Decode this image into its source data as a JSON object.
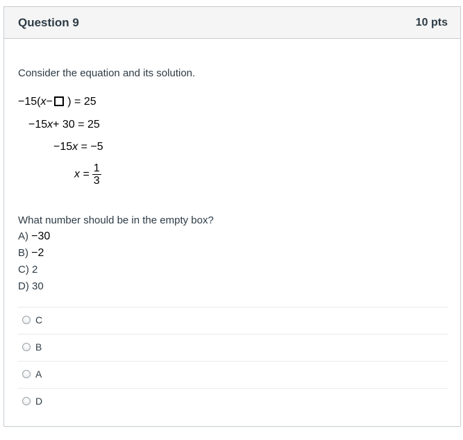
{
  "header": {
    "title": "Question 9",
    "points": "10 pts"
  },
  "prompt": "Consider the equation and its solution.",
  "equations": {
    "line1_prefix": "−15(",
    "line1_var": "x",
    "line1_minus": "−",
    "line1_suffix": " ) = 25",
    "line2_left": "−15",
    "line2_var": "x",
    "line2_right": "+ 30 = 25",
    "line3_left": "−15",
    "line3_var": "x",
    "line3_right": " = −5",
    "line4_var": "x",
    "line4_eq": " =",
    "line4_num": "1",
    "line4_den": "3"
  },
  "question_text": "What number should be in the empty box?",
  "choices": [
    {
      "letter": "A)",
      "value": "−30"
    },
    {
      "letter": "B)",
      "value": "−2"
    },
    {
      "letter": "C)",
      "value": "2"
    },
    {
      "letter": "D)",
      "value": "30"
    }
  ],
  "answers": [
    {
      "label": "C"
    },
    {
      "label": "B"
    },
    {
      "label": "A"
    },
    {
      "label": "D"
    }
  ]
}
